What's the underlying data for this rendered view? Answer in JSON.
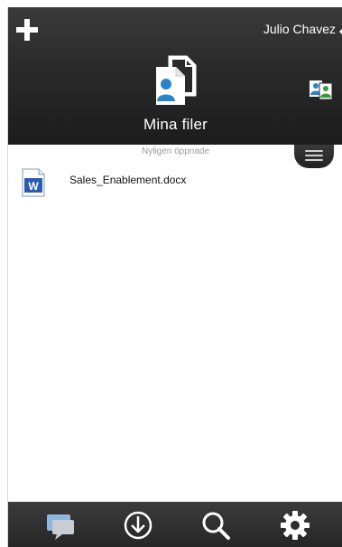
{
  "header": {
    "user_name": "Julio Chavez",
    "title": "Mina filer"
  },
  "list": {
    "section_label": "Nyligen öppnade",
    "files": [
      {
        "name": "Sales_Enablement.docx",
        "icon": "word-document-icon"
      }
    ]
  },
  "toolbar": {
    "items": [
      "chat-icon",
      "download-icon",
      "search-icon",
      "settings-gear-icon"
    ]
  },
  "colors": {
    "header_bg": "#2a2a2a",
    "text_on_dark": "#ffffff",
    "section_label": "#9a9a9a",
    "word_blue": "#2a5db0",
    "person_blue": "#2b83c9"
  }
}
